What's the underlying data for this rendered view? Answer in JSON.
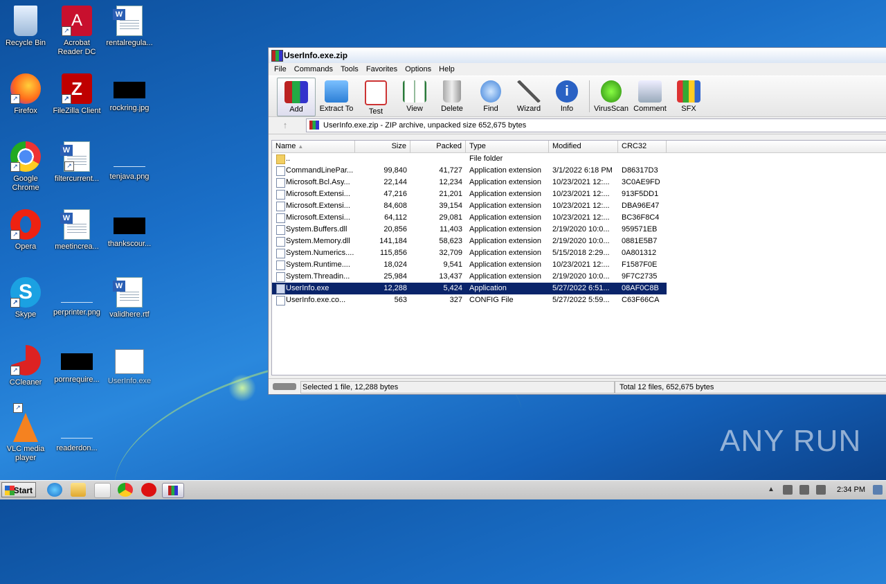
{
  "desktop": {
    "icons": [
      {
        "label": "Recycle Bin"
      },
      {
        "label": "Acrobat Reader DC"
      },
      {
        "label": "rentalregula..."
      },
      {
        "label": "Firefox"
      },
      {
        "label": "FileZilla Client"
      },
      {
        "label": "rockring.jpg"
      },
      {
        "label": "Google Chrome"
      },
      {
        "label": "filtercurrent..."
      },
      {
        "label": "tenjava.png"
      },
      {
        "label": "Opera"
      },
      {
        "label": "meetincrea..."
      },
      {
        "label": "thankscour..."
      },
      {
        "label": "Skype"
      },
      {
        "label": "perprinter.png"
      },
      {
        "label": "validhere.rtf"
      },
      {
        "label": "CCleaner"
      },
      {
        "label": "pornrequire..."
      },
      {
        "label": "UserInfo.exe"
      },
      {
        "label": "VLC media player"
      },
      {
        "label": "readerdon..."
      }
    ],
    "watermark": "ANY RUN"
  },
  "window": {
    "title": "UserInfo.exe.zip",
    "menu": [
      "File",
      "Commands",
      "Tools",
      "Favorites",
      "Options",
      "Help"
    ],
    "toolbar": [
      "Add",
      "Extract To",
      "Test",
      "View",
      "Delete",
      "Find",
      "Wizard",
      "Info",
      "VirusScan",
      "Comment",
      "SFX"
    ],
    "address": "UserInfo.exe.zip - ZIP archive, unpacked size 652,675 bytes",
    "columns": [
      "Name",
      "Size",
      "Packed",
      "Type",
      "Modified",
      "CRC32"
    ],
    "rows": [
      {
        "name": "..",
        "size": "",
        "packed": "",
        "type": "File folder",
        "modified": "",
        "crc": ""
      },
      {
        "name": "CommandLinePar...",
        "size": "99,840",
        "packed": "41,727",
        "type": "Application extension",
        "modified": "3/1/2022 6:18 PM",
        "crc": "D86317D3"
      },
      {
        "name": "Microsoft.Bcl.Asy...",
        "size": "22,144",
        "packed": "12,234",
        "type": "Application extension",
        "modified": "10/23/2021 12:...",
        "crc": "3C0AE9FD"
      },
      {
        "name": "Microsoft.Extensi...",
        "size": "47,216",
        "packed": "21,201",
        "type": "Application extension",
        "modified": "10/23/2021 12:...",
        "crc": "913F5DD1"
      },
      {
        "name": "Microsoft.Extensi...",
        "size": "84,608",
        "packed": "39,154",
        "type": "Application extension",
        "modified": "10/23/2021 12:...",
        "crc": "DBA96E47"
      },
      {
        "name": "Microsoft.Extensi...",
        "size": "64,112",
        "packed": "29,081",
        "type": "Application extension",
        "modified": "10/23/2021 12:...",
        "crc": "BC36F8C4"
      },
      {
        "name": "System.Buffers.dll",
        "size": "20,856",
        "packed": "11,403",
        "type": "Application extension",
        "modified": "2/19/2020 10:0...",
        "crc": "959571EB"
      },
      {
        "name": "System.Memory.dll",
        "size": "141,184",
        "packed": "58,623",
        "type": "Application extension",
        "modified": "2/19/2020 10:0...",
        "crc": "0881E5B7"
      },
      {
        "name": "System.Numerics....",
        "size": "115,856",
        "packed": "32,709",
        "type": "Application extension",
        "modified": "5/15/2018 2:29...",
        "crc": "0A801312"
      },
      {
        "name": "System.Runtime....",
        "size": "18,024",
        "packed": "9,541",
        "type": "Application extension",
        "modified": "10/23/2021 12:...",
        "crc": "F1587F0E"
      },
      {
        "name": "System.Threadin...",
        "size": "25,984",
        "packed": "13,437",
        "type": "Application extension",
        "modified": "2/19/2020 10:0...",
        "crc": "9F7C2735"
      },
      {
        "name": "UserInfo.exe",
        "size": "12,288",
        "packed": "5,424",
        "type": "Application",
        "modified": "5/27/2022 6:51...",
        "crc": "08AF0C8B"
      },
      {
        "name": "UserInfo.exe.co...",
        "size": "563",
        "packed": "327",
        "type": "CONFIG File",
        "modified": "5/27/2022 5:59...",
        "crc": "C63F66CA"
      }
    ],
    "status_left": "Selected 1 file, 12,288 bytes",
    "status_right": "Total 12 files, 652,675 bytes"
  },
  "taskbar": {
    "start_label": "Start",
    "clock": "2:34 PM"
  }
}
